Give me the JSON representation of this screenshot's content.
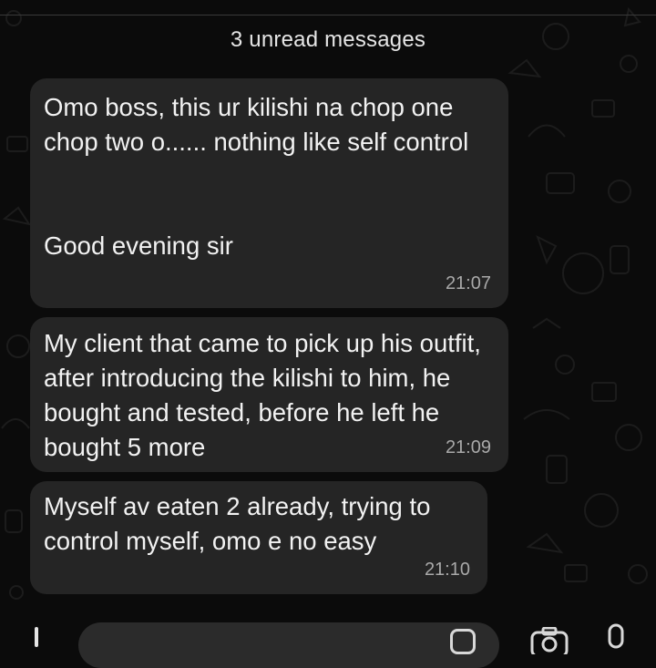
{
  "banner": {
    "unread_text": "3 unread messages"
  },
  "messages": [
    {
      "text": "Omo boss, this ur kilishi na chop one chop two o...... nothing like self control",
      "text2": "Good evening sir",
      "time": "21:07"
    },
    {
      "text": "My client that came to pick up his outfit, after introducing the kilishi to him, he bought and tested, before he left he bought 5 more",
      "time": "21:09"
    },
    {
      "text": "Myself av eaten 2 already, trying to control myself, omo e no easy",
      "time": "21:10"
    }
  ],
  "input_bar": {
    "icons": [
      "plus-icon",
      "sticker-icon",
      "camera-icon",
      "microphone-icon"
    ]
  },
  "colors": {
    "background": "#0b0b0b",
    "bubble": "#252525",
    "text": "#f2f2f2",
    "timestamp": "#a9a9a9"
  }
}
